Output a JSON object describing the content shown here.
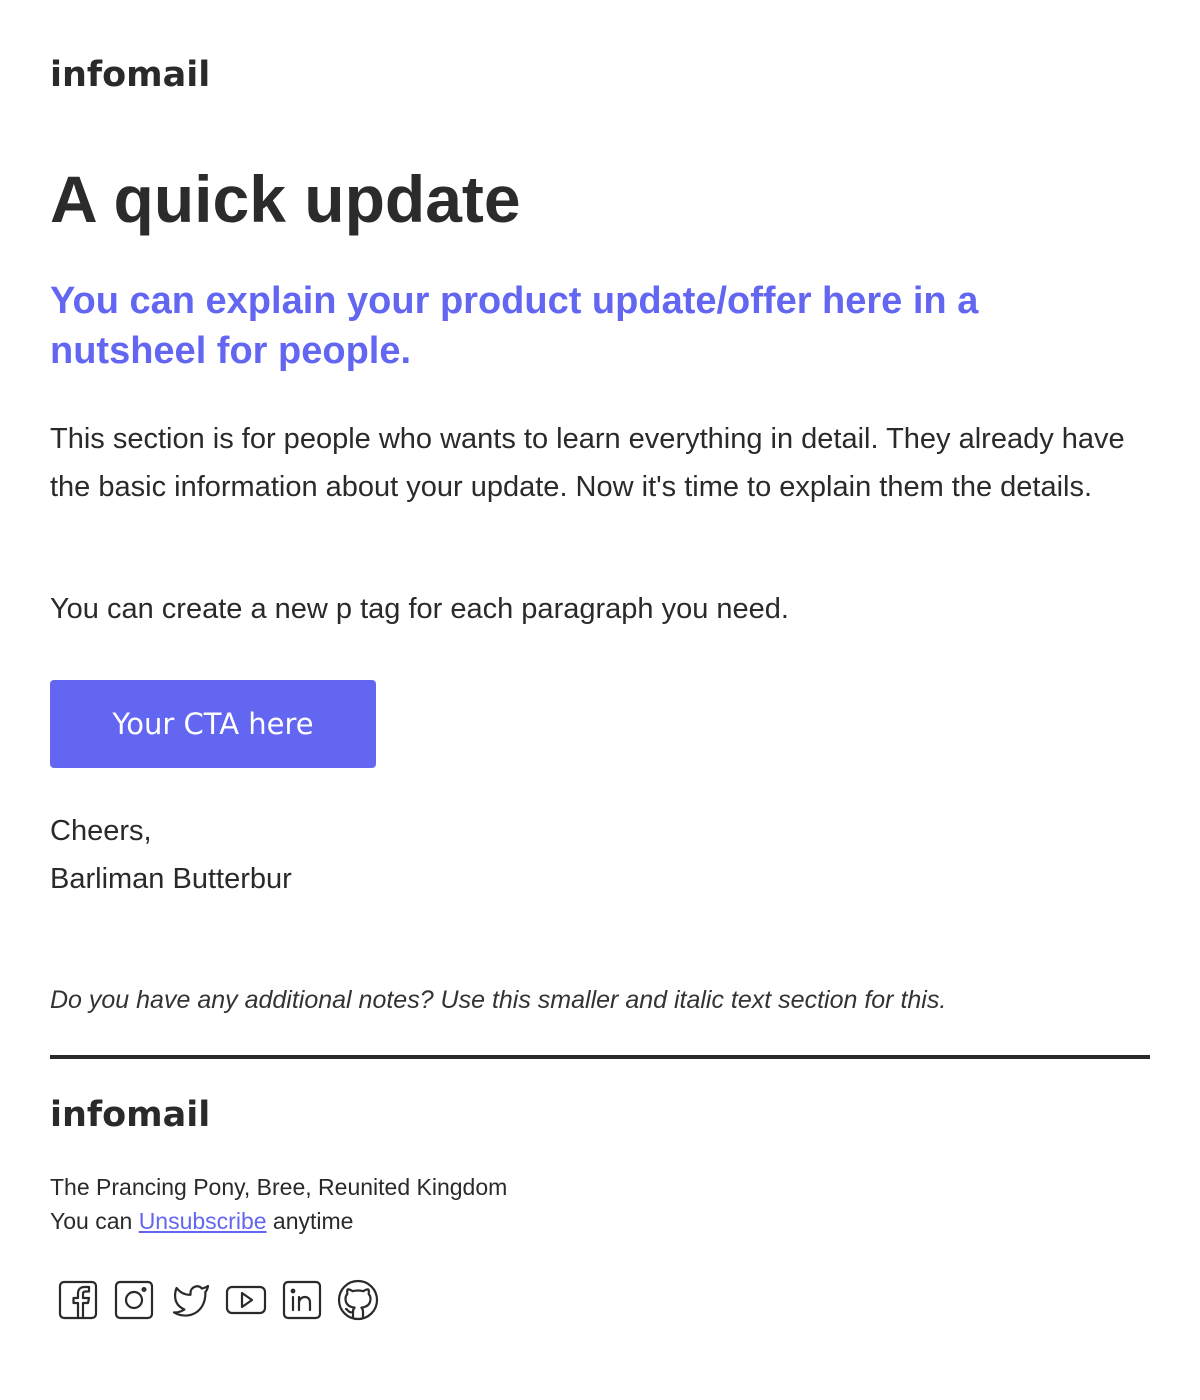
{
  "brand": {
    "logo_text": "infomail"
  },
  "email": {
    "headline": "A quick update",
    "subheadline": "You can explain your product update/offer here in a nutsheel for people.",
    "paragraphs": [
      "This section is for people who wants to learn everything in detail. They already have the basic information about your update. Now it's time to explain them the details.",
      "You can create a new p tag for each paragraph you need."
    ],
    "cta_label": "Your CTA here",
    "signoff": {
      "greeting": "Cheers,",
      "name": "Barliman Butterbur"
    },
    "note": "Do you have any additional notes? Use this smaller and italic text section for this."
  },
  "footer": {
    "logo_text": "infomail",
    "address": "The Prancing Pony, Bree, Reunited Kingdom",
    "unsubscribe_prefix": "You can",
    "unsubscribe_link": "Unsubscribe",
    "unsubscribe_suffix": "anytime",
    "social_icons": [
      "facebook-icon",
      "instagram-icon",
      "twitter-icon",
      "youtube-icon",
      "linkedin-icon",
      "github-icon"
    ]
  },
  "colors": {
    "accent": "#6366f1",
    "text": "#2a2a2a",
    "background": "#ffffff"
  }
}
